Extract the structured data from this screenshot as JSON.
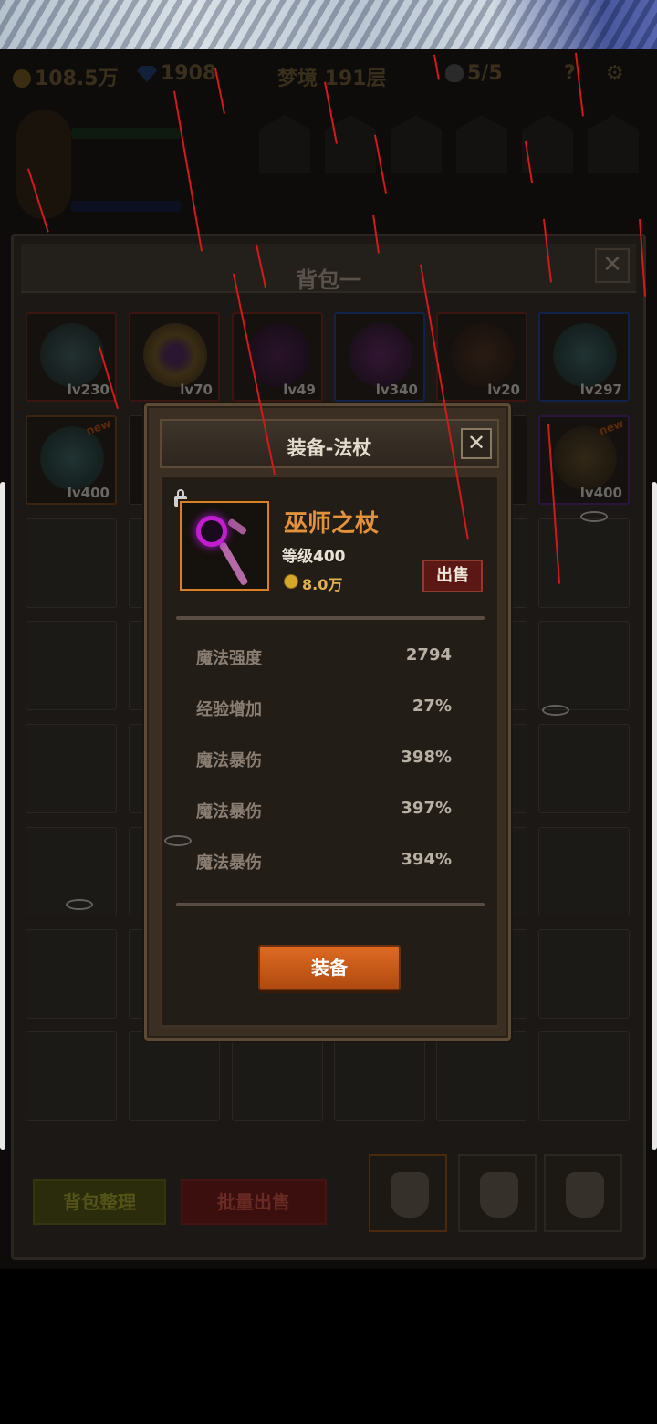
{
  "top_bar": {
    "gold": "108.5万",
    "gems": "1908",
    "stage": "梦境 191层",
    "skulls": "5/5",
    "help": "?"
  },
  "backpack": {
    "title": "背包一",
    "close_symbol": "✕",
    "row1": [
      {
        "level": "lv230",
        "rarity": "red",
        "icon": "scythe-icon"
      },
      {
        "level": "lv70",
        "rarity": "red",
        "icon": "ring-icon"
      },
      {
        "level": "lv49",
        "rarity": "red",
        "icon": "feather-icon"
      },
      {
        "level": "lv340",
        "rarity": "blue",
        "icon": "staff-icon"
      },
      {
        "level": "lv20",
        "rarity": "red",
        "icon": "claw-icon"
      },
      {
        "level": "lv297",
        "rarity": "blue",
        "icon": "orb-icon"
      }
    ],
    "row2": [
      {
        "level": "lv400",
        "rarity": "orange",
        "icon": "orb-icon",
        "new": "new"
      },
      {
        "level": "lv400",
        "rarity": "purple",
        "icon": "feather-icon",
        "new": "new"
      }
    ],
    "sort_button": "背包整理",
    "bulk_sell_button": "批量出售"
  },
  "modal": {
    "title": "装备-法杖",
    "close_symbol": "✕",
    "item_name": "巫师之杖",
    "item_level": "等级400",
    "item_price": "8.0万",
    "sell_button": "出售",
    "equip_button": "装备",
    "stats": [
      {
        "label": "魔法强度",
        "value": "2794"
      },
      {
        "label": "经验增加",
        "value": "27%"
      },
      {
        "label": "魔法暴伤",
        "value": "398%"
      },
      {
        "label": "魔法暴伤",
        "value": "397%"
      },
      {
        "label": "魔法暴伤",
        "value": "394%"
      }
    ]
  },
  "colors": {
    "accent_orange": "#d6802a",
    "item_name": "#e3913a",
    "sell_red": "#5a1714",
    "equip_orange": "#dd6a22",
    "rain_red": "#d11a1a"
  }
}
